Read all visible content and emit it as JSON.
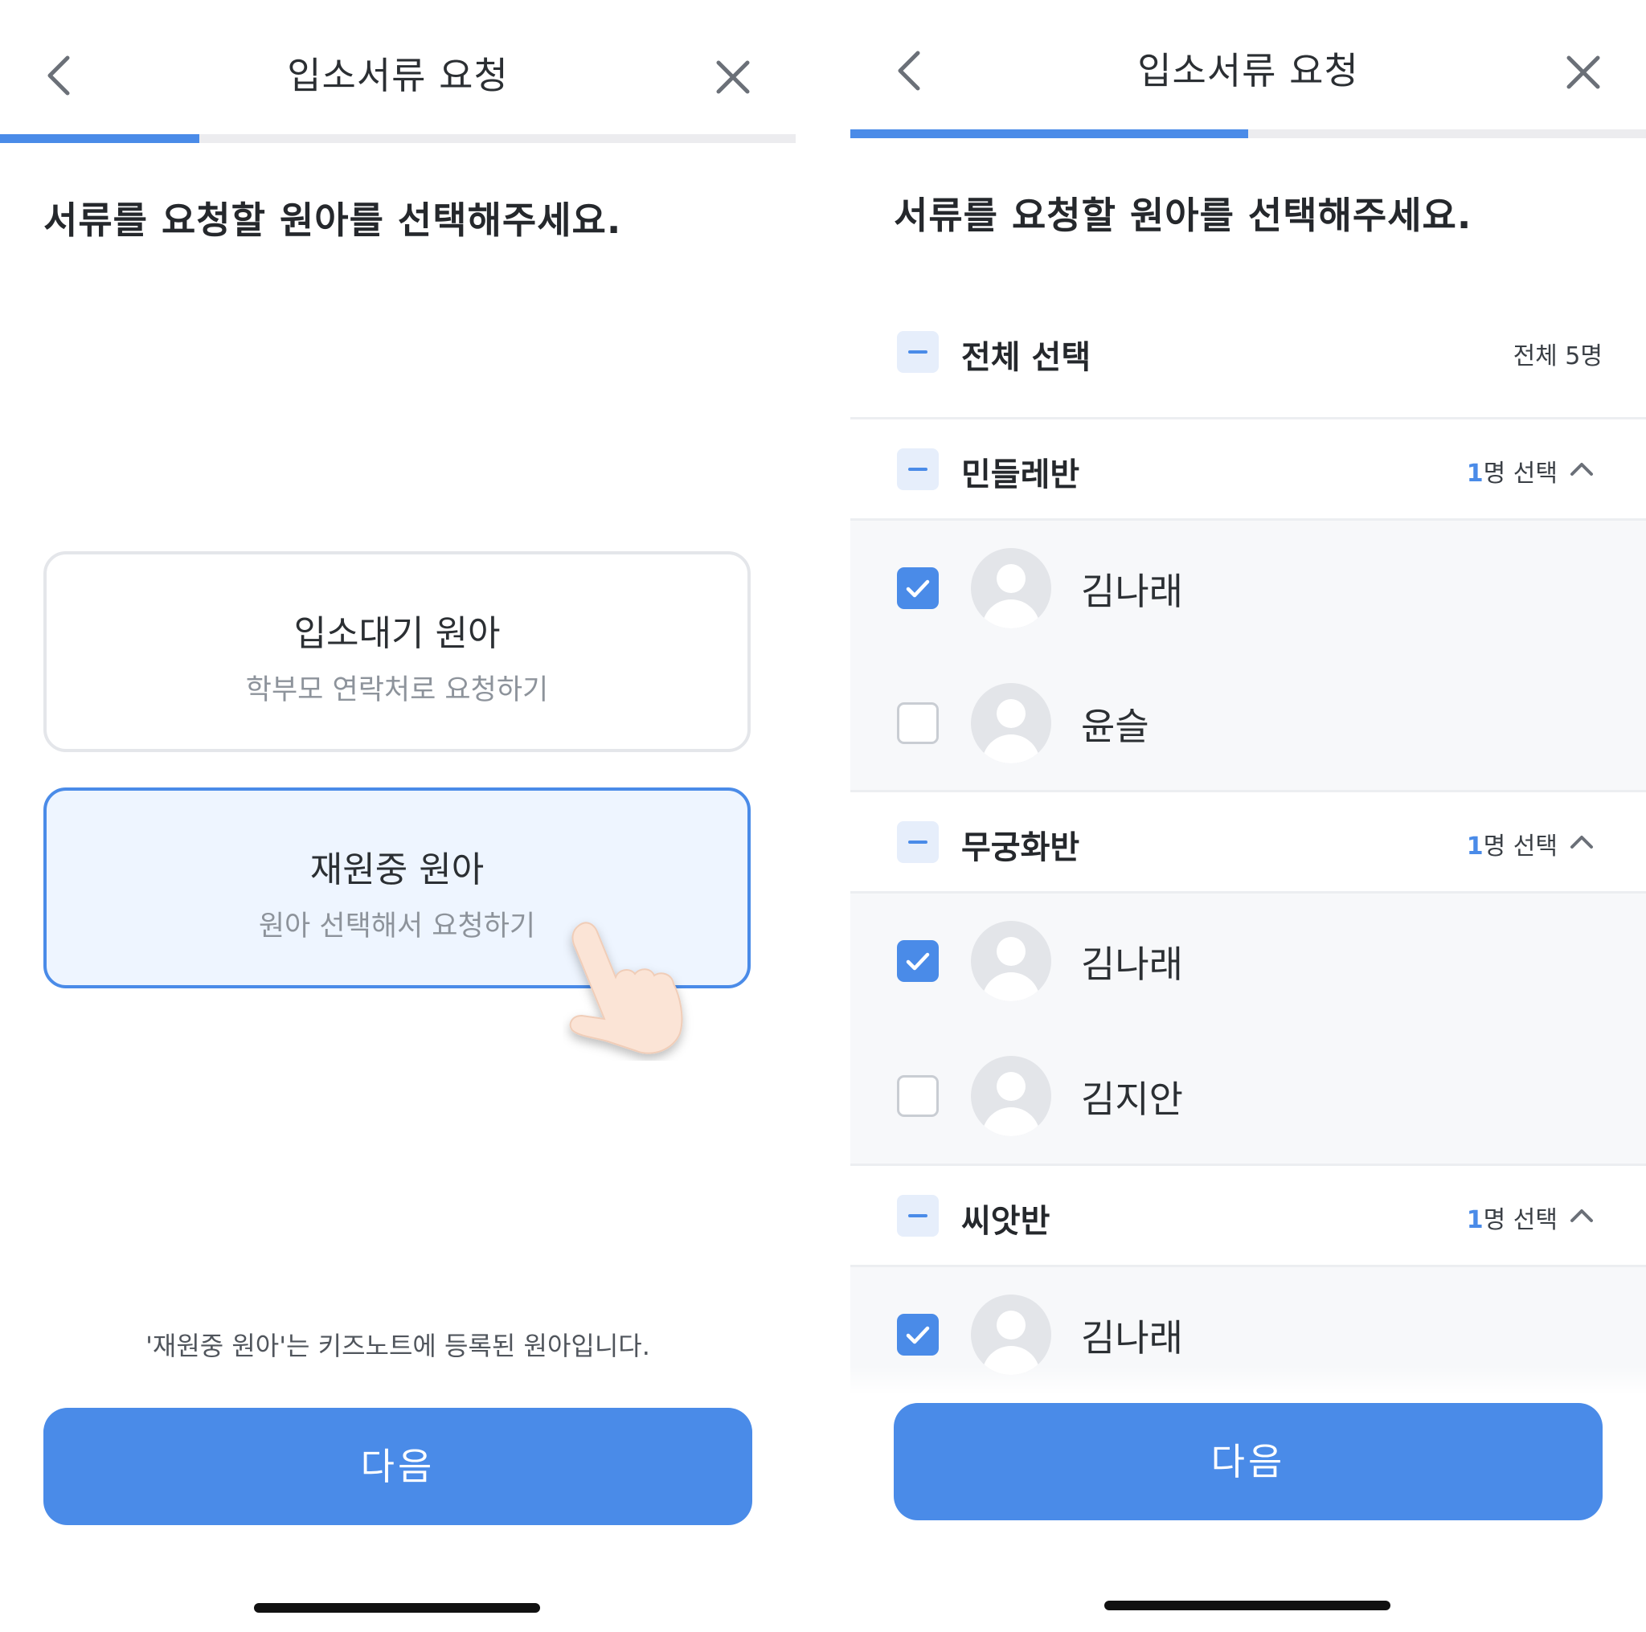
{
  "left": {
    "header": {
      "title": "입소서류 요청"
    },
    "progress": 0.25,
    "heading": "서류를 요청할 원아를 선택해주세요.",
    "options": [
      {
        "title": "입소대기 원아",
        "subtitle": "학부모 연락처로 요청하기",
        "selected": false
      },
      {
        "title": "재원중 원아",
        "subtitle": "원아 선택해서 요청하기",
        "selected": true
      }
    ],
    "note": "'재원중 원아'는 키즈노트에 등록된 원아입니다.",
    "next_label": "다음"
  },
  "right": {
    "header": {
      "title": "입소서류 요청"
    },
    "progress": 0.5,
    "heading": "서류를 요청할 원아를 선택해주세요.",
    "select_all": {
      "label": "전체 선택",
      "total": "전체 5명"
    },
    "groups": [
      {
        "name": "민들레반",
        "count": "1",
        "count_suffix": "명 선택",
        "children": [
          {
            "name": "김나래",
            "checked": true
          },
          {
            "name": "윤슬",
            "checked": false
          }
        ]
      },
      {
        "name": "무궁화반",
        "count": "1",
        "count_suffix": "명 선택",
        "children": [
          {
            "name": "김나래",
            "checked": true
          },
          {
            "name": "김지안",
            "checked": false
          }
        ]
      },
      {
        "name": "씨앗반",
        "count": "1",
        "count_suffix": "명 선택",
        "children": [
          {
            "name": "김나래",
            "checked": true
          }
        ]
      }
    ],
    "next_label": "다음"
  },
  "colors": {
    "accent": "#4a8be8",
    "active_bg": "#eef5ff",
    "list_bg": "#f7f8fa"
  },
  "icons": {
    "back": "chevron-left-icon",
    "close": "close-icon",
    "collapse": "chevron-up-icon",
    "hand": "hand-pointer-icon"
  }
}
